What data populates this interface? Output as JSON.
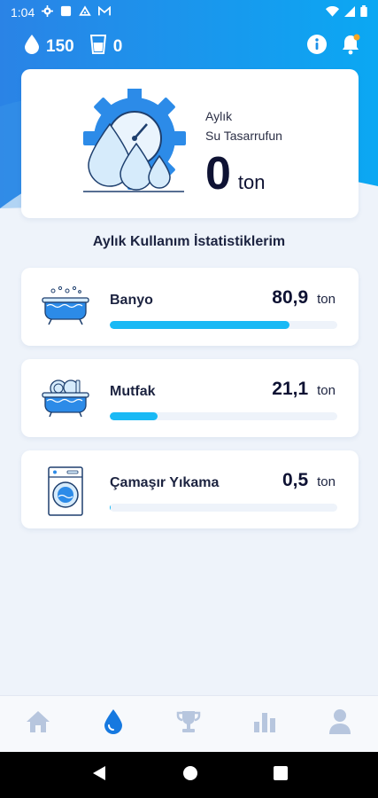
{
  "status_bar": {
    "time": "1:04"
  },
  "header": {
    "drops_count": "150",
    "glass_count": "0"
  },
  "savings": {
    "label_line1": "Aylık",
    "label_line2": "Su Tasarrufun",
    "value": "0",
    "unit": "ton"
  },
  "stats_title": "Aylık Kullanım İstatistiklerim",
  "stats": [
    {
      "name": "Banyo",
      "value": "80,9",
      "unit": "ton",
      "progress": 0.79,
      "icon": "bathtub-icon"
    },
    {
      "name": "Mutfak",
      "value": "21,1",
      "unit": "ton",
      "progress": 0.21,
      "icon": "kitchen-sink-icon"
    },
    {
      "name": "Çamaşır Yıkama",
      "value": "0,5",
      "unit": "ton",
      "progress": 0.005,
      "icon": "washing-machine-icon"
    }
  ],
  "colors": {
    "primary_blue": "#1a8fe8",
    "accent_cyan": "#19b9f5",
    "nav_active": "#1679e0",
    "nav_inactive": "#b7c6de"
  },
  "bottom_nav": [
    {
      "icon": "home-icon",
      "active": false
    },
    {
      "icon": "water-drop-icon",
      "active": true
    },
    {
      "icon": "trophy-icon",
      "active": false
    },
    {
      "icon": "bar-chart-icon",
      "active": false
    },
    {
      "icon": "profile-icon",
      "active": false
    }
  ]
}
